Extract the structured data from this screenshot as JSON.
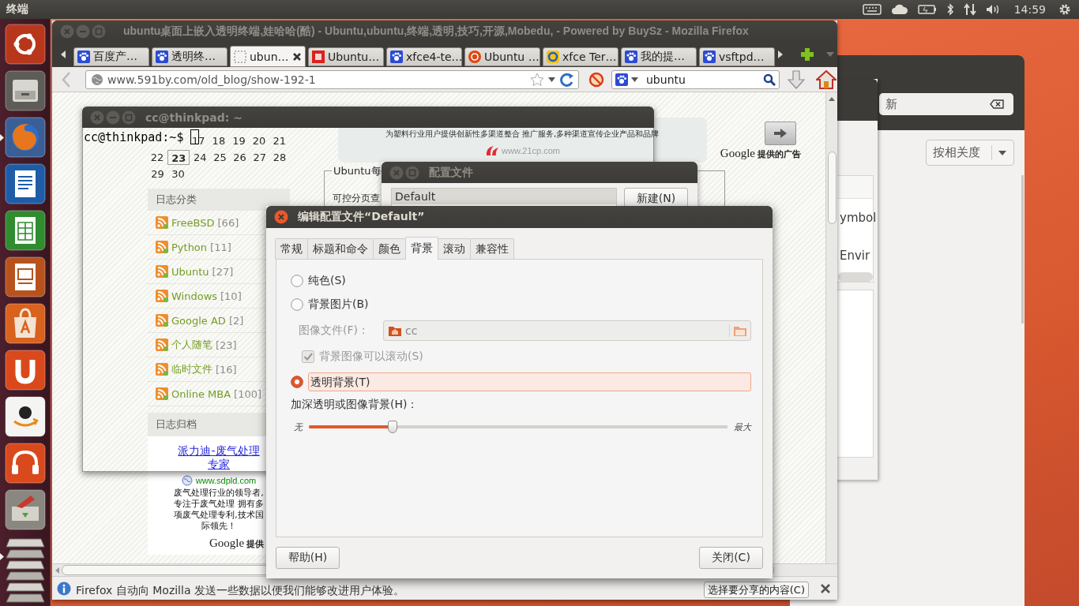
{
  "top_panel": {
    "app_title": "终端",
    "clock": "14:59"
  },
  "launcher": [
    {
      "kind": "dash",
      "running": false
    },
    {
      "kind": "files",
      "running": false
    },
    {
      "kind": "firefox",
      "running": true
    },
    {
      "kind": "writer",
      "running": false
    },
    {
      "kind": "calc",
      "running": false
    },
    {
      "kind": "impress",
      "running": false
    },
    {
      "kind": "software",
      "running": false
    },
    {
      "kind": "ubuntu_one",
      "running": false
    },
    {
      "kind": "amazon",
      "running": false
    },
    {
      "kind": "music",
      "running": false
    },
    {
      "kind": "update",
      "running": false
    },
    {
      "kind": "stack",
      "running": true
    }
  ],
  "software_window": {
    "search": {
      "value": "新"
    },
    "sort": "按相关度"
  },
  "side_window": {
    "lines": [
      "ymbol",
      "Envir"
    ]
  },
  "firefox": {
    "title": "ubuntu桌面上嵌入透明终端,娃哈哈(酷) - Ubuntu,ubuntu,终端,透明,技巧,开源,Mobedu, - Powered by BuySz - Mozilla Firefox",
    "tabs": [
      {
        "kind": "paw",
        "label": "百度产…",
        "selected": false
      },
      {
        "kind": "paw",
        "label": "透明终…",
        "selected": false
      },
      {
        "kind": "blank",
        "label": "ubun…",
        "selected": true
      },
      {
        "kind": "red",
        "label": "Ubuntu…",
        "selected": false
      },
      {
        "kind": "paw",
        "label": "xfce4-te…",
        "selected": false
      },
      {
        "kind": "ubuntu",
        "label": "Ubuntu …",
        "selected": false
      },
      {
        "kind": "ring",
        "label": "xfce Ter…",
        "selected": false
      },
      {
        "kind": "paw",
        "label": "我的提…",
        "selected": false
      },
      {
        "kind": "paw",
        "label": "vsftpd…",
        "selected": false
      }
    ],
    "url": "www.591by.com/old_blog/show-192-1",
    "search": {
      "value": "ubuntu"
    },
    "page": {
      "calendar": [
        [
          {
            "day": "17",
            "today": false
          },
          {
            "day": "18",
            "today": false
          },
          {
            "day": "19",
            "today": false
          },
          {
            "day": "20",
            "today": false
          },
          {
            "day": "21",
            "today": false
          }
        ],
        [
          {
            "day": "22",
            "today": false
          },
          {
            "day": "23",
            "today": true
          },
          {
            "day": "24",
            "today": false
          },
          {
            "day": "25",
            "today": false
          },
          {
            "day": "26",
            "today": false
          },
          {
            "day": "27",
            "today": false
          },
          {
            "day": "28",
            "today": false
          }
        ],
        [
          {
            "day": "29",
            "today": false
          },
          {
            "day": "30",
            "today": false
          }
        ]
      ],
      "categories_heading": "日志分类",
      "categories": [
        {
          "name": "FreeBSD",
          "count": "[66]"
        },
        {
          "name": "Python",
          "count": "[11]"
        },
        {
          "name": "Ubuntu",
          "count": "[27]"
        },
        {
          "name": "Windows",
          "count": "[10]"
        },
        {
          "name": "Google AD",
          "count": "[2]"
        },
        {
          "name": "个人随笔",
          "count": "[23]"
        },
        {
          "name": "临时文件",
          "count": "[16]"
        },
        {
          "name": "Online MBA",
          "count": "[100]"
        }
      ],
      "archive_heading": "日志归档",
      "side_ad": {
        "link": "派力迪-废气处理专家",
        "url": "www.sdpld.com",
        "text": "废气处理行业的领导者,专注于废气处理 拥有多项废气处理专利,技术国际领先！",
        "google": "Google",
        "provided": "提供"
      },
      "top_ad": {
        "text": "为塑料行业用户提供创新性多渠道整合 推广服务,多种渠道宣传企业产品和品牌",
        "url": "www.21cp.com",
        "google": "Google",
        "provided": "提供的广告"
      },
      "box_legend": "Ubuntu每",
      "box_text": "可控分页查"
    },
    "notification": {
      "text": "Firefox 自动向 Mozilla 发送一些数据以便我们能够改进用户体验。",
      "button": "选择要分享的内容(C)"
    }
  },
  "terminal": {
    "title": "cc@thinkpad: ~",
    "prompt": "cc@thinkpad:~$ "
  },
  "profiles_dialog": {
    "title": "配置文件",
    "profiles": [
      {
        "name": "Default",
        "selected": true
      }
    ],
    "new_button": "新建(N)"
  },
  "edit_dialog": {
    "title": "编辑配置文件“Default”",
    "tabs": [
      {
        "label": "常规",
        "selected": false
      },
      {
        "label": "标题和命令",
        "selected": false
      },
      {
        "label": "颜色",
        "selected": false
      },
      {
        "label": "背景",
        "selected": true
      },
      {
        "label": "滚动",
        "selected": false
      },
      {
        "label": "兼容性",
        "selected": false
      }
    ],
    "options": [
      {
        "kind": "radio",
        "label": "纯色(S)",
        "selected": false
      },
      {
        "kind": "radio",
        "label": "背景图片(B)",
        "selected": false
      },
      {
        "kind": "file",
        "label": "图像文件(F)：",
        "value": "cc",
        "disabled": true
      },
      {
        "kind": "check",
        "label": "背景图像可以滚动(S)",
        "checked": true,
        "disabled": true
      },
      {
        "kind": "radio",
        "label": "透明背景(T)",
        "selected": true
      },
      {
        "kind": "slider",
        "label": "加深透明或图像背景(H)：",
        "min_label": "无",
        "max_label": "最大",
        "level": 0.2
      }
    ],
    "help_button": "帮助(H)",
    "close_button": "关闭(C)"
  }
}
